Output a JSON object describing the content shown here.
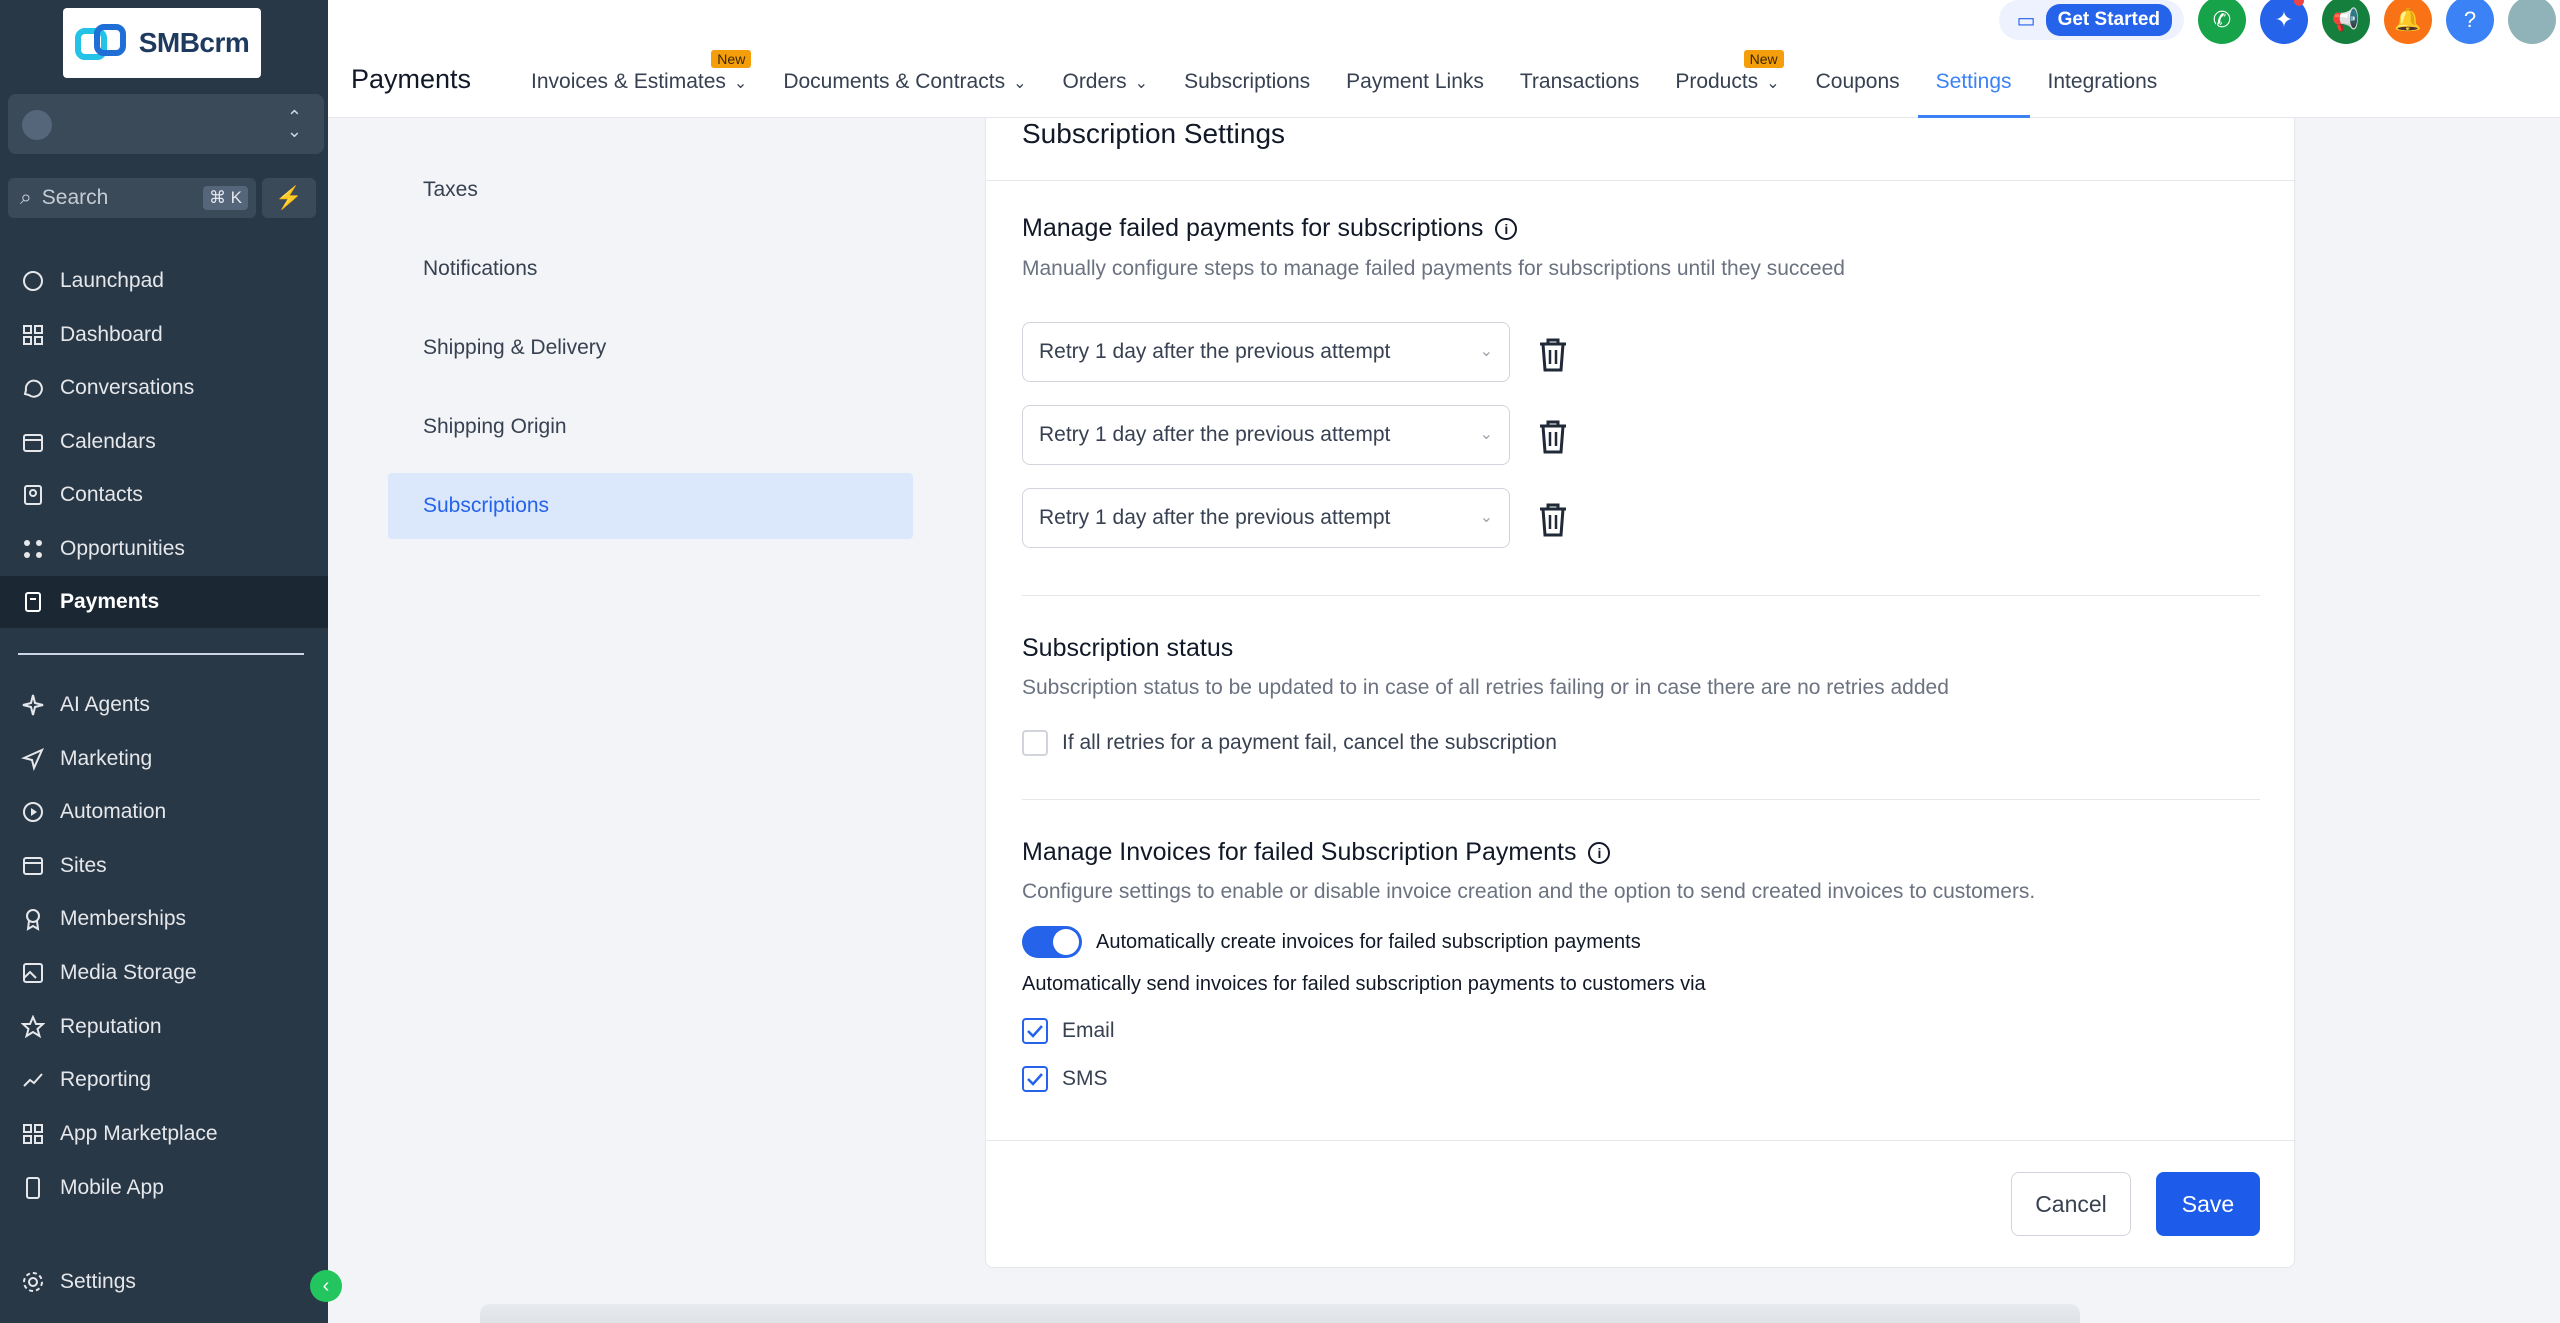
{
  "brand": {
    "logo_text": "SMBcrm"
  },
  "sidebar": {
    "search_placeholder": "Search",
    "search_shortcut": "⌘ K",
    "items": [
      {
        "label": "Launchpad",
        "icon": "launchpad-icon"
      },
      {
        "label": "Dashboard",
        "icon": "dashboard-icon"
      },
      {
        "label": "Conversations",
        "icon": "chat-icon"
      },
      {
        "label": "Calendars",
        "icon": "calendar-icon"
      },
      {
        "label": "Contacts",
        "icon": "contacts-icon"
      },
      {
        "label": "Opportunities",
        "icon": "opportunities-icon"
      },
      {
        "label": "Payments",
        "icon": "payments-icon",
        "active": true
      },
      {
        "label": "AI Agents",
        "icon": "ai-agents-icon"
      },
      {
        "label": "Marketing",
        "icon": "marketing-icon"
      },
      {
        "label": "Automation",
        "icon": "automation-icon"
      },
      {
        "label": "Sites",
        "icon": "sites-icon"
      },
      {
        "label": "Memberships",
        "icon": "memberships-icon"
      },
      {
        "label": "Media Storage",
        "icon": "media-icon"
      },
      {
        "label": "Reputation",
        "icon": "star-icon"
      },
      {
        "label": "Reporting",
        "icon": "reporting-icon"
      },
      {
        "label": "App Marketplace",
        "icon": "marketplace-icon"
      },
      {
        "label": "Mobile App",
        "icon": "mobile-icon"
      }
    ],
    "settings_label": "Settings"
  },
  "header": {
    "title": "Payments",
    "tabs": [
      {
        "label": "Invoices & Estimates",
        "badge": "New",
        "dropdown": true
      },
      {
        "label": "Documents & Contracts",
        "dropdown": true
      },
      {
        "label": "Orders",
        "dropdown": true
      },
      {
        "label": "Subscriptions"
      },
      {
        "label": "Payment Links"
      },
      {
        "label": "Transactions"
      },
      {
        "label": "Products",
        "badge": "New",
        "dropdown": true
      },
      {
        "label": "Coupons"
      },
      {
        "label": "Settings",
        "active": true
      },
      {
        "label": "Integrations"
      }
    ],
    "get_started": "Get Started",
    "help": "?"
  },
  "settings_nav": {
    "items": [
      "Taxes",
      "Notifications",
      "Shipping & Delivery",
      "Shipping Origin",
      "Subscriptions"
    ],
    "active": "Subscriptions"
  },
  "card": {
    "title": "Subscription Settings",
    "failed_payments": {
      "title": "Manage failed payments for subscriptions",
      "desc": "Manually configure steps to manage failed payments for subscriptions until they succeed",
      "retries": [
        "Retry 1 day after the previous attempt",
        "Retry 1 day after the previous attempt",
        "Retry 1 day after the previous attempt"
      ]
    },
    "status": {
      "title": "Subscription status",
      "desc": "Subscription status to be updated to in case of all retries failing or in case there are no retries added",
      "checkbox_label": "If all retries for a payment fail, cancel the subscription",
      "checked": false
    },
    "invoices": {
      "title": "Manage Invoices for failed Subscription Payments",
      "desc": "Configure settings to enable or disable invoice creation and the option to send created invoices to customers.",
      "toggle_label": "Automatically create invoices for failed subscription payments",
      "toggle_on": true,
      "send_via_label": "Automatically send invoices for failed subscription payments to customers via",
      "channels": [
        {
          "label": "Email",
          "checked": true
        },
        {
          "label": "SMS",
          "checked": true
        }
      ]
    },
    "cancel_label": "Cancel",
    "save_label": "Save"
  },
  "colors": {
    "accent": "#1d5bea",
    "sidebar_bg": "#293846",
    "active_tab": "#3b82f6"
  }
}
